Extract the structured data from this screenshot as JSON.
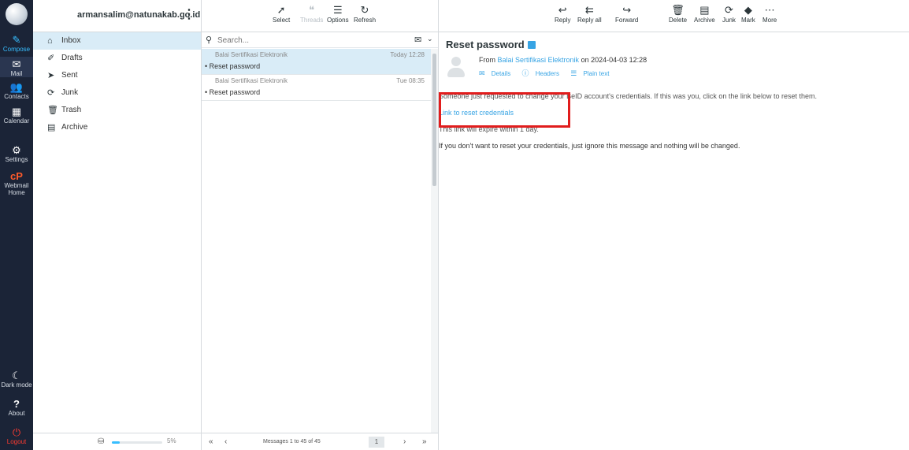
{
  "account": {
    "email": "armansalim@natunakab.go.id"
  },
  "rail": {
    "compose": "Compose",
    "mail": "Mail",
    "contacts": "Contacts",
    "calendar": "Calendar",
    "settings": "Settings",
    "webmail_home_1": "Webmail",
    "webmail_home_2": "Home",
    "dark_mode": "Dark mode",
    "about": "About",
    "logout": "Logout"
  },
  "folders": [
    {
      "label": "Inbox",
      "icon": "inbox-icon"
    },
    {
      "label": "Drafts",
      "icon": "pencil-icon"
    },
    {
      "label": "Sent",
      "icon": "paper-plane-icon"
    },
    {
      "label": "Junk",
      "icon": "junk-icon"
    },
    {
      "label": "Trash",
      "icon": "trash-icon"
    },
    {
      "label": "Archive",
      "icon": "archive-icon"
    }
  ],
  "quota": {
    "percent": 5,
    "label": "5%"
  },
  "list_toolbar": {
    "select": "Select",
    "threads": "Threads",
    "options": "Options",
    "refresh": "Refresh"
  },
  "search": {
    "placeholder": "Search..."
  },
  "messages": [
    {
      "from": "Balai Sertifikasi Elektronik",
      "date": "Today 12:28",
      "subject": "Reset password"
    },
    {
      "from": "Balai Sertifikasi Elektronik",
      "date": "Tue 08:35",
      "subject": "Reset password"
    }
  ],
  "pagination": {
    "count": "Messages 1 to 45 of 45",
    "page": "1"
  },
  "read_toolbar": {
    "reply": "Reply",
    "reply_all": "Reply all",
    "forward": "Forward",
    "delete": "Delete",
    "archive": "Archive",
    "junk": "Junk",
    "mark": "Mark",
    "more": "More"
  },
  "email": {
    "subject": "Reset password",
    "from_prefix": "From",
    "sender": "Balai Sertifikasi Elektronik",
    "date_text": "on 2024-04-03 12:28",
    "details": "Details",
    "headers": "Headers",
    "plain_text": "Plain text",
    "line1": "Someone just requested to change your BeID account's credentials. If this was you, click on the link below to reset them.",
    "link": "Link to reset credentials",
    "line3": "This link will expire within 1 day.",
    "line4": "If you don't want to reset your credentials, just ignore this message and nothing will be changed."
  },
  "colors": {
    "rail": "#1b2437",
    "accent": "#37beff",
    "selected": "#d9ecf7",
    "highlight_box": "#e11d1d"
  }
}
